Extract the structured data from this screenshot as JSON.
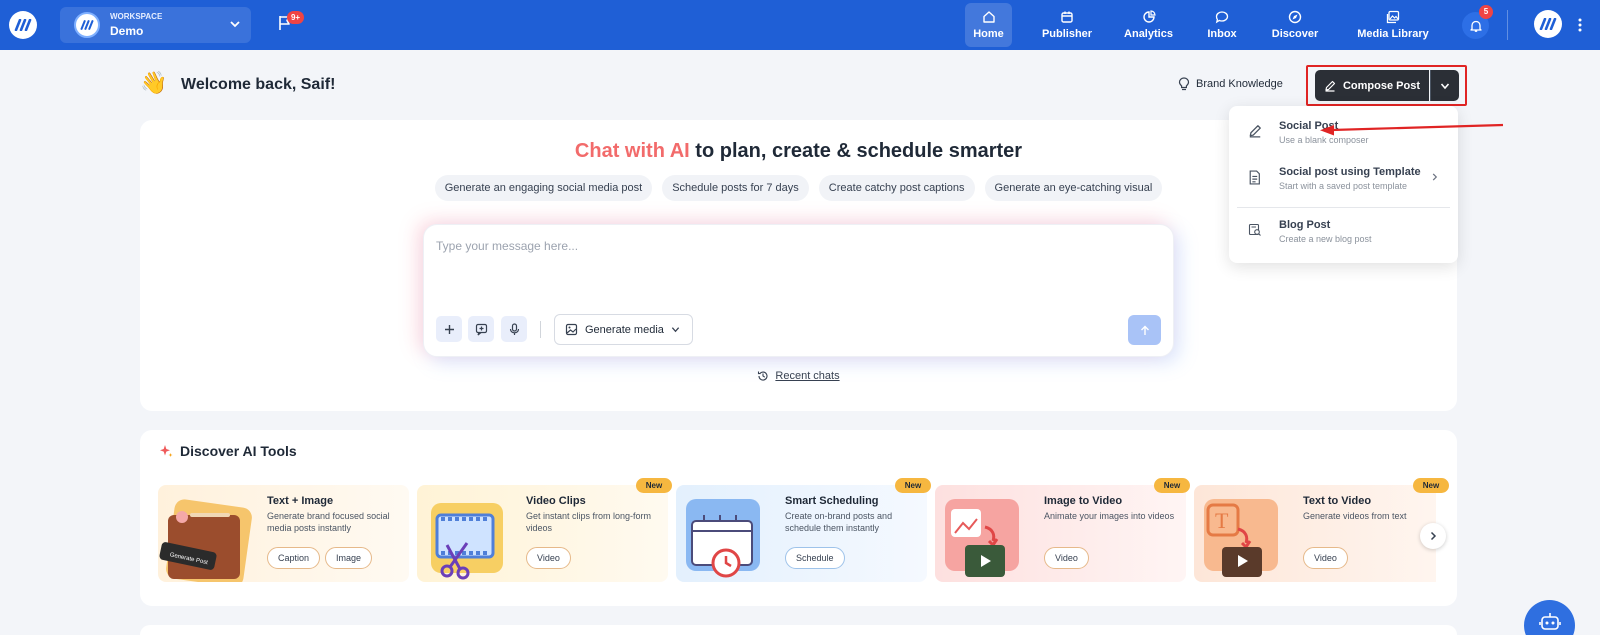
{
  "topbar": {
    "workspace_label": "WORKSPACE",
    "workspace_name": "Demo",
    "flag_badge": "9+",
    "bell_badge": "5",
    "nav": [
      {
        "label": "Home",
        "icon": "home-icon",
        "active": true
      },
      {
        "label": "Publisher",
        "icon": "calendar-icon"
      },
      {
        "label": "Analytics",
        "icon": "pie-chart-icon"
      },
      {
        "label": "Inbox",
        "icon": "chat-icon"
      },
      {
        "label": "Discover",
        "icon": "compass-icon"
      },
      {
        "label": "Media Library",
        "icon": "images-icon"
      }
    ]
  },
  "header": {
    "welcome": "Welcome back, Saif!",
    "brand_knowledge": "Brand Knowledge",
    "compose_label": "Compose Post"
  },
  "hero": {
    "title_highlight": "Chat with AI",
    "title_rest": " to plan, create & schedule smarter",
    "chips": [
      "Generate an engaging social media post",
      "Schedule posts for 7 days",
      "Create catchy post captions",
      "Generate an eye-catching visual"
    ],
    "input_placeholder": "Type your message here...",
    "generate_media": "Generate media",
    "recent_chats": "Recent chats"
  },
  "dropdown": {
    "items": [
      {
        "title": "Social Post",
        "subtitle": "Use a blank composer"
      },
      {
        "title": "Social post using Template",
        "subtitle": "Start with a saved post template"
      },
      {
        "title": "Blog Post",
        "subtitle": "Create a new blog post"
      }
    ]
  },
  "discover": {
    "title": "Discover AI Tools",
    "new_label": "New",
    "cards": [
      {
        "title": "Text + Image",
        "desc": "Generate brand focused social media posts instantly",
        "tags": [
          "Caption",
          "Image"
        ],
        "art_label": "Generate Post"
      },
      {
        "title": "Video Clips",
        "desc": "Get instant clips from long-form videos",
        "tags": [
          "Video"
        ]
      },
      {
        "title": "Smart Scheduling",
        "desc": "Create on-brand posts and schedule them instantly",
        "tags": [
          "Schedule"
        ]
      },
      {
        "title": "Image to Video",
        "desc": "Animate your images into videos",
        "tags": [
          "Video"
        ]
      },
      {
        "title": "Text to Video",
        "desc": "Generate videos from text",
        "tags": [
          "Video"
        ]
      }
    ]
  },
  "colors": {
    "brand_blue": "#1f5fd6",
    "compose_dark": "#2b2f36",
    "highlight_red": "#e02424",
    "new_badge": "#f6b740"
  }
}
